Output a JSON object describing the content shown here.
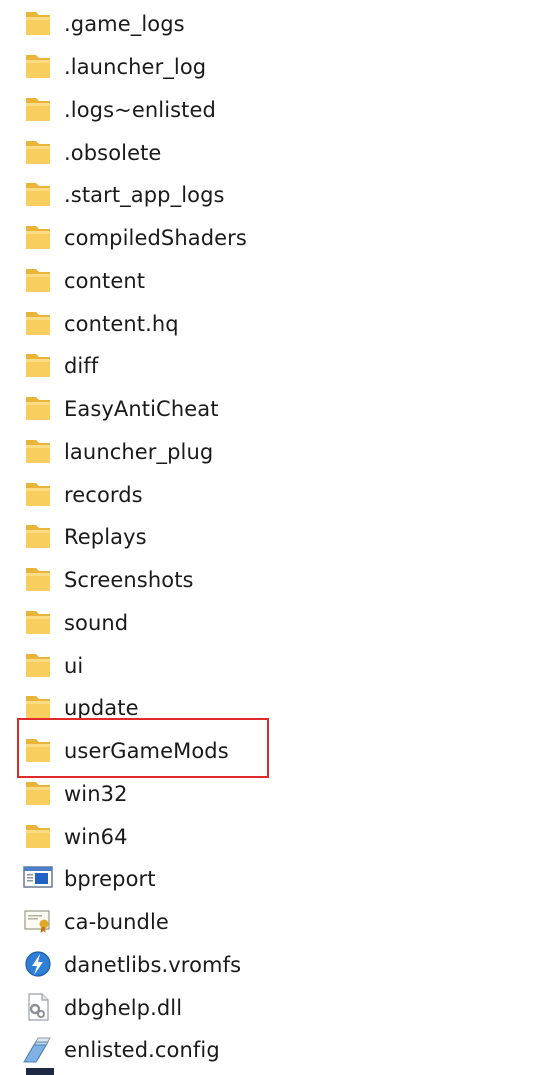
{
  "explorer": {
    "items": [
      {
        "name": ".game_logs",
        "icon": "folder-icon"
      },
      {
        "name": ".launcher_log",
        "icon": "folder-icon"
      },
      {
        "name": ".logs~enlisted",
        "icon": "folder-icon"
      },
      {
        "name": ".obsolete",
        "icon": "folder-icon"
      },
      {
        "name": ".start_app_logs",
        "icon": "folder-icon"
      },
      {
        "name": "compiledShaders",
        "icon": "folder-icon"
      },
      {
        "name": "content",
        "icon": "folder-icon"
      },
      {
        "name": "content.hq",
        "icon": "folder-icon"
      },
      {
        "name": "diff",
        "icon": "folder-icon"
      },
      {
        "name": "EasyAntiCheat",
        "icon": "folder-icon"
      },
      {
        "name": "launcher_plug",
        "icon": "folder-icon"
      },
      {
        "name": "records",
        "icon": "folder-icon"
      },
      {
        "name": "Replays",
        "icon": "folder-icon"
      },
      {
        "name": "Screenshots",
        "icon": "folder-icon"
      },
      {
        "name": "sound",
        "icon": "folder-icon"
      },
      {
        "name": "ui",
        "icon": "folder-icon"
      },
      {
        "name": "update",
        "icon": "folder-icon"
      },
      {
        "name": "userGameMods",
        "icon": "folder-icon",
        "highlighted": true
      },
      {
        "name": "win32",
        "icon": "folder-icon"
      },
      {
        "name": "win64",
        "icon": "folder-icon"
      },
      {
        "name": "bpreport",
        "icon": "report-app-icon"
      },
      {
        "name": "ca-bundle",
        "icon": "certificate-icon"
      },
      {
        "name": "danetlibs.vromfs",
        "icon": "vromfs-file-icon"
      },
      {
        "name": "dbghelp.dll",
        "icon": "dll-file-icon"
      },
      {
        "name": "enlisted.config",
        "icon": "config-file-icon"
      }
    ]
  },
  "colors": {
    "highlight": "#e02a2a",
    "folder": "#f8cf5f"
  }
}
